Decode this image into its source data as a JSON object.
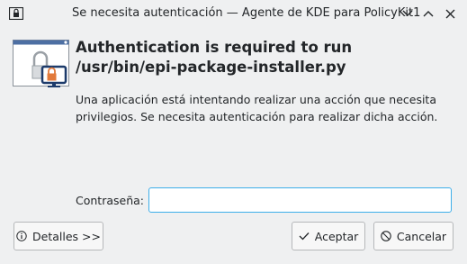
{
  "window": {
    "title": "Se necesita autenticación — Agente de KDE para PolicyKit1"
  },
  "icons": {
    "title_icon": "lock-window-icon",
    "dialog_icon": "security-lock-computer-icon",
    "minimize": "chevron-down-icon",
    "maximize": "chevron-up-icon",
    "close": "close-icon",
    "details": "info-icon",
    "accept": "check-icon",
    "cancel": "cancel-icon"
  },
  "dialog": {
    "heading": "Authentication is required to run /usr/bin/epi-package-installer.py",
    "message": "Una aplicación está intentando realizar una acción que necesita privilegios. Se necesita autenticación para realizar dicha acción.",
    "password_label": "Contraseña:",
    "password_value": ""
  },
  "buttons": {
    "details": "Detalles >>",
    "accept": "Aceptar",
    "cancel": "Cancelar"
  },
  "colors": {
    "background": "#eff0f1",
    "focus": "#3daee9",
    "lock": "#e27a3b",
    "monitor": "#1d3b6b"
  }
}
